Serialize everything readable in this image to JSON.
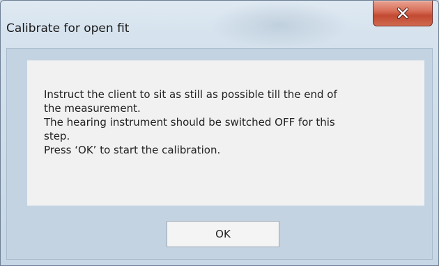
{
  "window": {
    "title": "Calibrate for open fit",
    "close_icon": "close-icon"
  },
  "message": {
    "lines": [
      "Instruct the client to sit as still as possible till the end of",
      "the measurement.",
      "The hearing instrument should be switched OFF for this",
      "step.",
      "Press ‘OK’ to start the calibration."
    ]
  },
  "buttons": {
    "ok_label": "OK"
  },
  "colors": {
    "frame": "#c8d7e5",
    "panel": "#f1f1f1",
    "close_button": "#c24a32"
  }
}
